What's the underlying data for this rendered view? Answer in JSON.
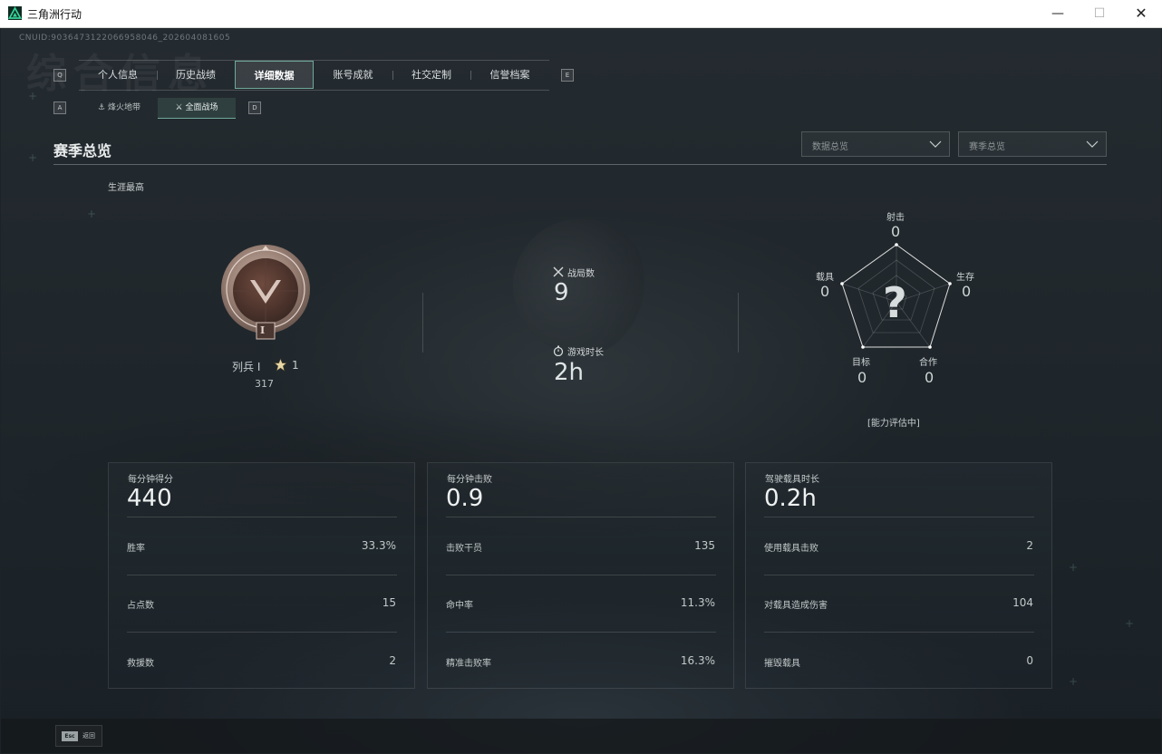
{
  "window": {
    "title": "三角洲行动"
  },
  "header": {
    "uid": "CNUID:9036473122066958046_202604081605",
    "bg_text": "综合信息"
  },
  "top_tabs": [
    {
      "label": "个人信息"
    },
    {
      "label": "历史战绩"
    },
    {
      "label": "详细数据",
      "active": true
    },
    {
      "label": "账号成就"
    },
    {
      "label": "社交定制"
    },
    {
      "label": "信誉档案"
    }
  ],
  "key_hints": {
    "tabs_left": "Q",
    "tabs_right": "E",
    "sub_left": "A",
    "sub_right": "D"
  },
  "sub_tabs": [
    {
      "label": "烽火地带"
    },
    {
      "label": "全面战场",
      "active": true
    }
  ],
  "section": {
    "title": "赛季总览"
  },
  "filters": [
    {
      "placeholder": "数据总览"
    },
    {
      "placeholder": "赛季总览"
    }
  ],
  "career": {
    "label": "生涯最高",
    "rank_name": "列兵 I",
    "rank_numeral": "I",
    "stars": "1",
    "points": "317"
  },
  "summary": {
    "matches_label": "战局数",
    "matches_value": "9",
    "playtime_label": "游戏时长",
    "playtime_value": "2h"
  },
  "radar": {
    "axes": [
      {
        "label": "射击",
        "value": "0"
      },
      {
        "label": "生存",
        "value": "0"
      },
      {
        "label": "合作",
        "value": "0"
      },
      {
        "label": "目标",
        "value": "0"
      },
      {
        "label": "载具",
        "value": "0"
      }
    ],
    "center_symbol": "?",
    "status": "[能力评估中]"
  },
  "cards": [
    {
      "title": "每分钟得分",
      "big": "440",
      "rows": [
        {
          "label": "胜率",
          "value": "33.3%"
        },
        {
          "label": "占点数",
          "value": "15"
        },
        {
          "label": "救援数",
          "value": "2"
        }
      ]
    },
    {
      "title": "每分钟击败",
      "big": "0.9",
      "rows": [
        {
          "label": "击败干员",
          "value": "135"
        },
        {
          "label": "命中率",
          "value": "11.3%"
        },
        {
          "label": "精准击败率",
          "value": "16.3%"
        }
      ]
    },
    {
      "title": "驾驶载具时长",
      "big": "0.2h",
      "rows": [
        {
          "label": "使用载具击败",
          "value": "2"
        },
        {
          "label": "对载具造成伤害",
          "value": "104"
        },
        {
          "label": "摧毁载具",
          "value": "0"
        }
      ]
    }
  ],
  "footer": {
    "esc_key": "Esc",
    "esc_label": "返回"
  },
  "colors": {
    "accent": "#6fa99a",
    "background": "#1d2328",
    "text": "#dfe4e5"
  }
}
